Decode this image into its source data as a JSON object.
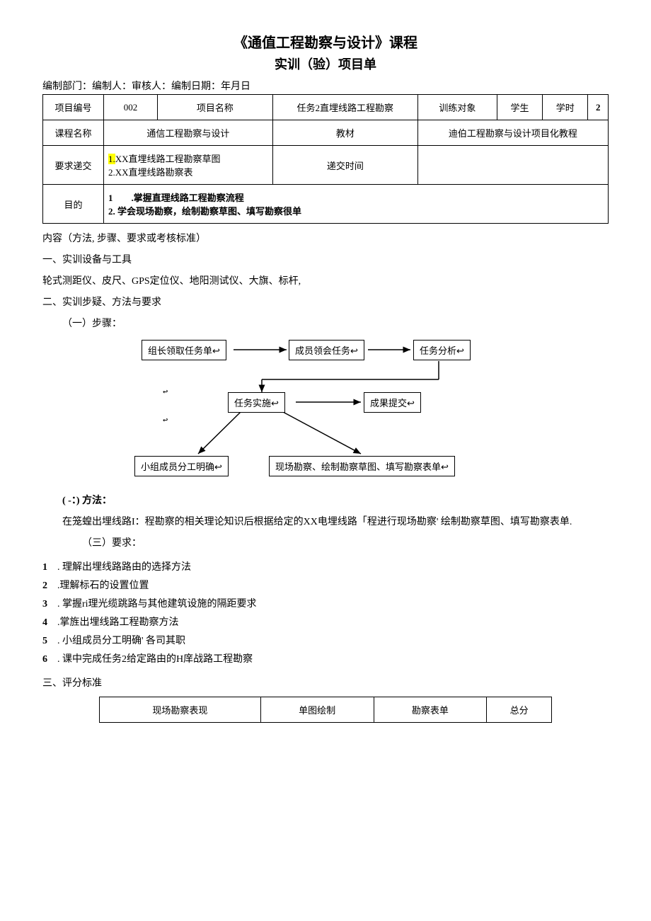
{
  "title": "《通值工程勘察与设计》课程",
  "subtitle": "实训（验）项目单",
  "meta_line": "编制部门：编制人：审核人：编制日期：年月日",
  "info": {
    "proj_no_label": "项目编号",
    "proj_no": "002",
    "proj_name_label": "项目名称",
    "proj_name": "任务2直埋线路工程勘察",
    "train_obj_label": "训练对象",
    "train_obj": "学生",
    "hours_label": "学时",
    "hours": "2",
    "course_label": "课程名称",
    "course": "通信工程勘察与设计",
    "textbook_label": "教材",
    "textbook": "迪伯工程勘察与设计项目化教程",
    "submit_label": "要求递交",
    "submit_1_prefix": "1.",
    "submit_1": "XX直埋线路工程勘察草图",
    "submit_2": "2.XX直埋线路勘察表",
    "submit_time_label": "递交时间",
    "purpose_label": "目的",
    "purpose_1": "1  .掌握直理线路工程勘察流程",
    "purpose_2": "2. 学会现场勘察，绘制勘察草图、填写勘察很单"
  },
  "content_label": "内容（方法, 步骤、要求或考核标准）",
  "s1_title": "一、实训设备与工具",
  "s1_body": "轮式测距仪、皮尺、GPS定位仪、地阳测试仪、大旗、标杆,",
  "s2_title": "二、实训步疑、方法与要求",
  "s2_steps_label": "（一）步骤：",
  "flow": {
    "b1": "组长领取任务单↩",
    "b2": "成员领会任务↩",
    "b3": "任务分析↩",
    "b4": "任务实施↩",
    "b5": "成果提交↩",
    "b6": "小组成员分工明确↩",
    "b7": "现场勘察、绘制勘察草图、填写勘察表单↩",
    "ret": "↩"
  },
  "s2_method_label": "( -：) 方法：",
  "s2_method_body": "在笼蝗出埋线路I：程勘察的相关理论知识后根据给定的XX电埋线路「程进行现场勘察' 绘制勘察草图、填写勘察表单.",
  "s2_req_label": "（三）要求：",
  "requirements": [
    ". 理解出埋线路路由的选择方法",
    ".理解标石的设置位置",
    ". 掌握ri理光缆跳路与其他建筑设施的隔距要求",
    ".掌旌出埋线路工程勘察方法",
    ". 小组成员分工明确' 各司其职",
    ". 课中完成任务2给定路由的H庠战路工程勘察"
  ],
  "s3_title": "三、评分标准",
  "score": {
    "c1": "现场勘察表现",
    "c2": "单图绘制",
    "c3": "勘察表单",
    "c4": "总分"
  }
}
